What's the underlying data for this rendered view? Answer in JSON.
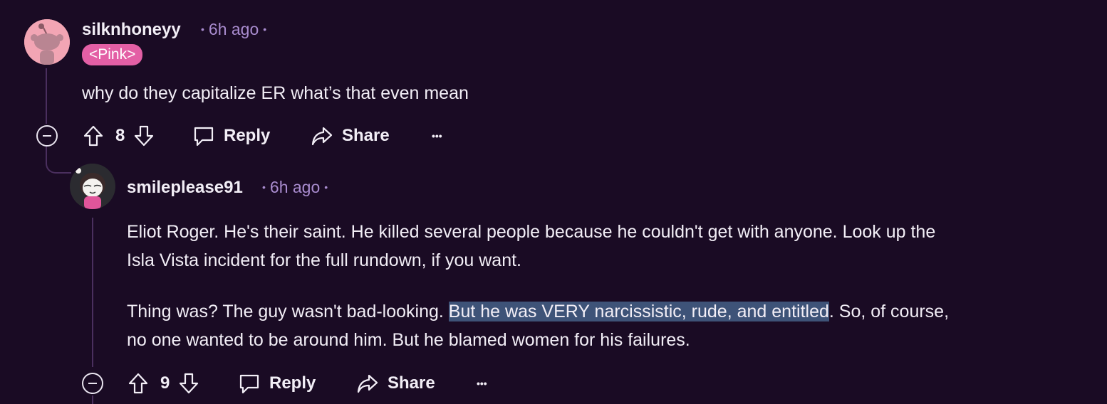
{
  "comments": [
    {
      "username": "silknhoneyy",
      "time": "6h ago",
      "flair": "<Pink>",
      "paragraphs": [
        {
          "before": "why do they capitalize ER what’s that even mean",
          "highlight": "",
          "after": ""
        }
      ],
      "votes": "8",
      "reply_label": "Reply",
      "share_label": "Share",
      "more_label": "•••"
    },
    {
      "username": "smileplease91",
      "time": "6h ago",
      "paragraphs": [
        {
          "line1": "Eliot Roger. He's their saint. He killed several people because he couldn't get with anyone. Look up the",
          "line2": "Isla Vista incident for the full rundown, if you want."
        },
        {
          "line1_before": "Thing was? The guy wasn't bad-looking. ",
          "line1_highlight": "But he was VERY narcissistic, rude, and entitled",
          "line1_after": ". So, of course,",
          "line2": "no one wanted to be around him. But he blamed women for his failures."
        }
      ],
      "votes": "9",
      "reply_label": "Reply",
      "share_label": "Share",
      "more_label": "•••"
    }
  ],
  "colors": {
    "background": "#1a0b24",
    "meta": "#a98ccf",
    "flair": "#e35fa5",
    "highlight": "#3e5378",
    "thread_line": "#4a2f5e"
  }
}
